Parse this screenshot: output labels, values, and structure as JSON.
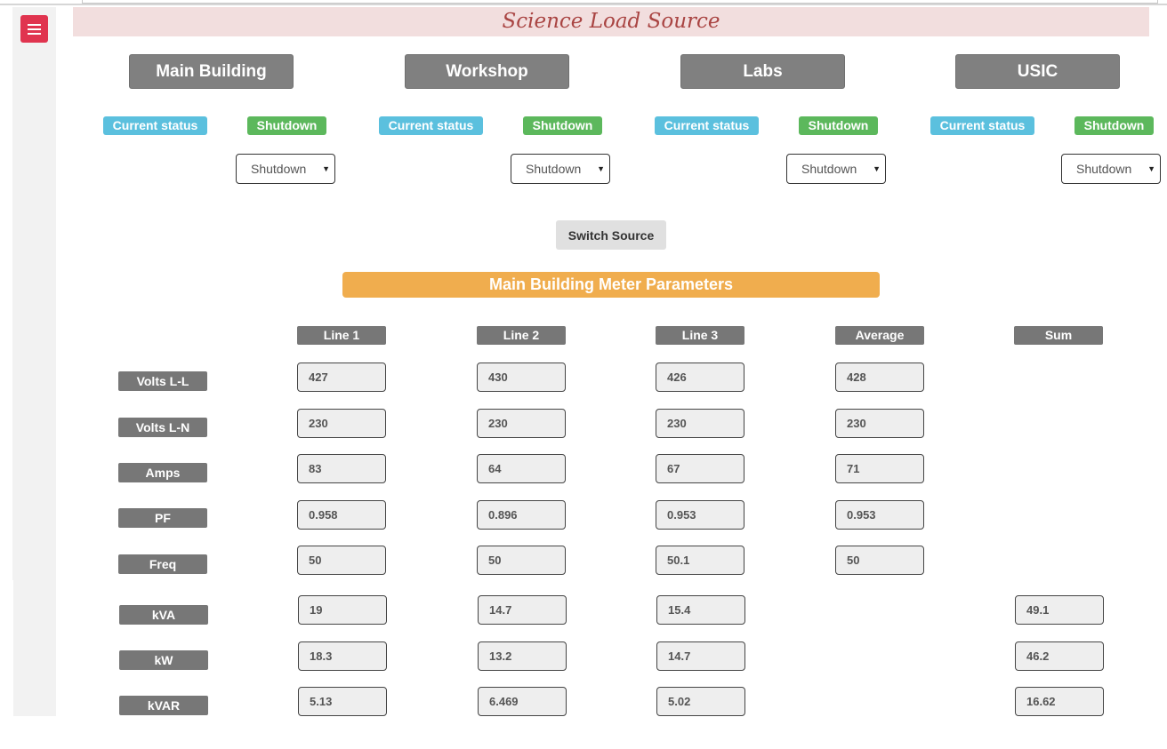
{
  "header": {
    "title": "Science Load Source"
  },
  "menu": {
    "icon": "hamburger-menu-icon"
  },
  "sites": [
    {
      "name": "Main Building",
      "status_label": "Current status",
      "status_value": "Shutdown",
      "select_value": "Shutdown"
    },
    {
      "name": "Workshop",
      "status_label": "Current status",
      "status_value": "Shutdown",
      "select_value": "Shutdown"
    },
    {
      "name": "Labs",
      "status_label": "Current status",
      "status_value": "Shutdown",
      "select_value": "Shutdown"
    },
    {
      "name": "USIC",
      "status_label": "Current status",
      "status_value": "Shutdown",
      "select_value": "Shutdown"
    }
  ],
  "switch_button": "Switch Source",
  "meter": {
    "title": "Main Building Meter Parameters",
    "columns": [
      "Line 1",
      "Line 2",
      "Line 3",
      "Average",
      "Sum"
    ],
    "rows": [
      {
        "label": "Volts L-L",
        "line1": "427",
        "line2": "430",
        "line3": "426",
        "average": "428",
        "sum": null
      },
      {
        "label": "Volts L-N",
        "line1": "230",
        "line2": "230",
        "line3": "230",
        "average": "230",
        "sum": null
      },
      {
        "label": "Amps",
        "line1": "83",
        "line2": "64",
        "line3": "67",
        "average": "71",
        "sum": null
      },
      {
        "label": "PF",
        "line1": "0.958",
        "line2": "0.896",
        "line3": "0.953",
        "average": "0.953",
        "sum": null
      },
      {
        "label": "Freq",
        "line1": "50",
        "line2": "50",
        "line3": "50.1",
        "average": "50",
        "sum": null
      },
      {
        "label": "kVA",
        "line1": "19",
        "line2": "14.7",
        "line3": "15.4",
        "average": null,
        "sum": "49.1"
      },
      {
        "label": "kW",
        "line1": "18.3",
        "line2": "13.2",
        "line3": "14.7",
        "average": null,
        "sum": "46.2"
      },
      {
        "label": "kVAR",
        "line1": "5.13",
        "line2": "6.469",
        "line3": "5.02",
        "average": null,
        "sum": "16.62"
      }
    ]
  }
}
